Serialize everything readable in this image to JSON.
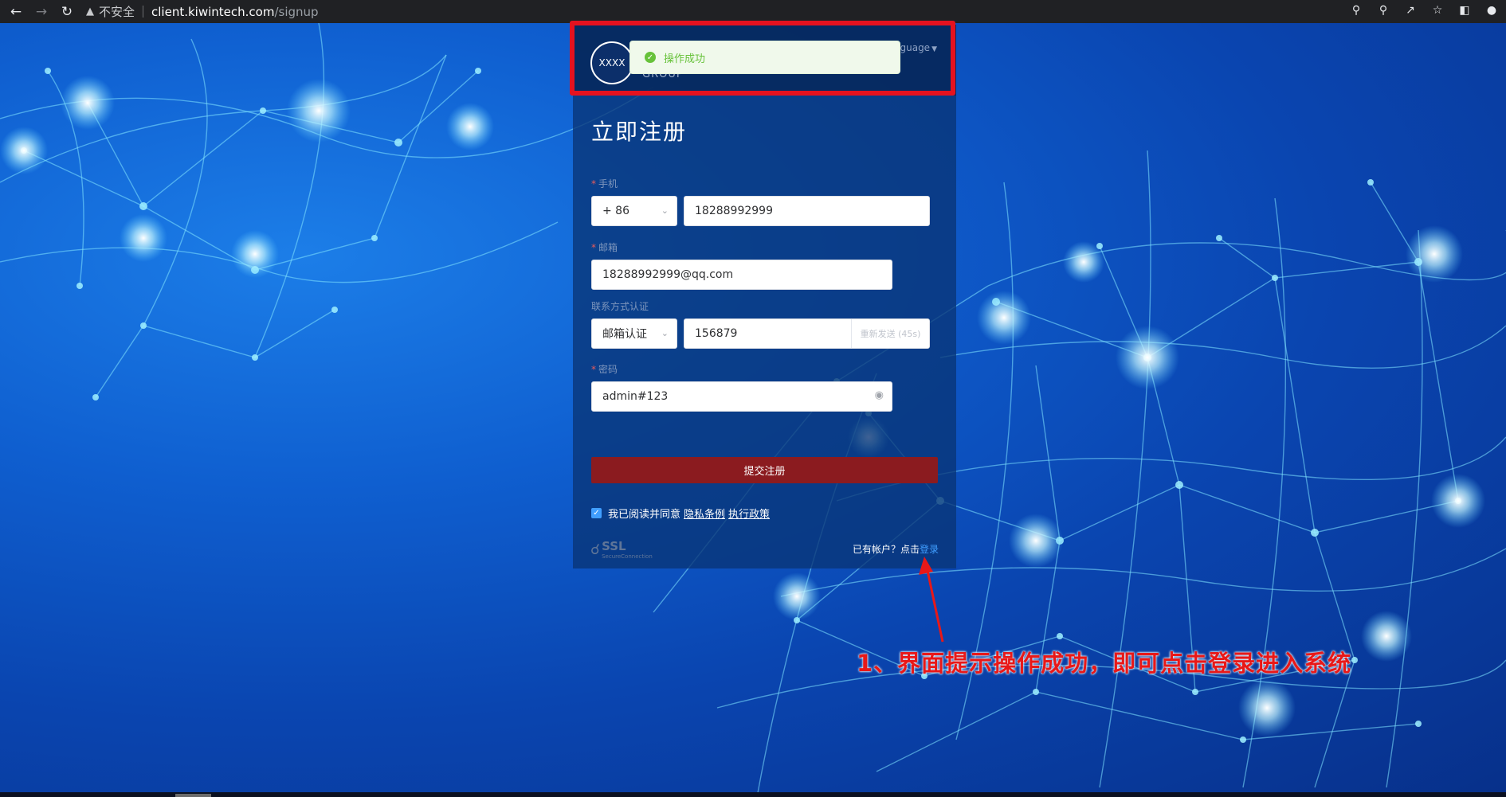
{
  "browser": {
    "back_icon": "back-arrow-icon",
    "forward_icon": "forward-arrow-icon",
    "reload_icon": "reload-icon",
    "security_label": "不安全",
    "url_host": "client.kiwintech.com",
    "url_path": "/signup",
    "right_icons": [
      "key-icon",
      "zoom-icon",
      "share-icon",
      "star-icon",
      "sidepanel-icon",
      "profile-icon"
    ]
  },
  "header": {
    "logo_text": "XXXX",
    "group_text": "GROUP",
    "language_label": "Language"
  },
  "toast": {
    "message": "操作成功",
    "status_color": "#67c23a"
  },
  "form": {
    "title": "立即注册",
    "phone_label": "手机",
    "country_code": "+ 86",
    "phone_value": "18288992999",
    "email_label": "邮箱",
    "email_value": "18288992999@qq.com",
    "verify_label": "联系方式认证",
    "verify_method": "邮箱认证",
    "verify_code": "156879",
    "resend_label": "重新发送 (45s)",
    "password_label": "密码",
    "password_value": "admin#123",
    "submit_label": "提交注册",
    "agree_text": "我已阅读并同意",
    "privacy_link": "隐私条例",
    "policy_link": "执行政策",
    "ssl_label": "SSL",
    "ssl_sub": "SecureConnection",
    "has_account_text": "已有帐户？点击",
    "login_link": "登录"
  },
  "annotation": {
    "text": "1、界面提示操作成功，即可点击登录进入系统",
    "color": "#e81818"
  },
  "colors": {
    "submit_bg": "#8b1b1f",
    "highlight_border": "#e5121f",
    "link_blue": "#409eff"
  }
}
